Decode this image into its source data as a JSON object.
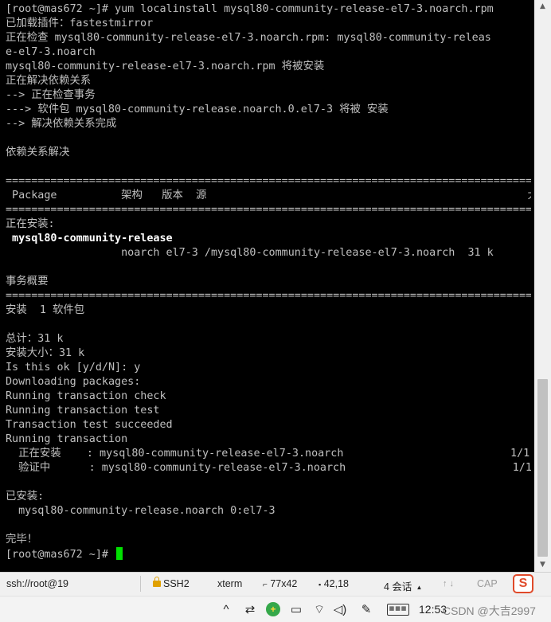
{
  "terminal": {
    "lines": [
      {
        "text": "[root@mas672 ~]# yum localinstall mysql80-community-release-el7-3.noarch.rpm"
      },
      {
        "text": "已加载插件：fastestmirror"
      },
      {
        "text": "正在检查 mysql80-community-release-el7-3.noarch.rpm: mysql80-community-releas"
      },
      {
        "text": "e-el7-3.noarch"
      },
      {
        "text": "mysql80-community-release-el7-3.noarch.rpm 将被安装"
      },
      {
        "text": "正在解决依赖关系"
      },
      {
        "text": "--> 正在检查事务"
      },
      {
        "text": "---> 软件包 mysql80-community-release.noarch.0.el7-3 将被 安装"
      },
      {
        "text": "--> 解决依赖关系完成"
      },
      {
        "text": ""
      },
      {
        "text": "依赖关系解决"
      },
      {
        "text": ""
      },
      {
        "text": "========================================================================================"
      },
      {
        "text": " Package          架构   版本  源                                                  大小"
      },
      {
        "text": "========================================================================================"
      },
      {
        "text": "正在安装:"
      },
      {
        "text": " mysql80-community-release",
        "bold": true
      },
      {
        "text": "                  noarch el7-3 /mysql80-community-release-el7-3.noarch  31 k"
      },
      {
        "text": ""
      },
      {
        "text": "事务概要"
      },
      {
        "text": "========================================================================================"
      },
      {
        "text": "安装  1 软件包"
      },
      {
        "text": ""
      },
      {
        "text": "总计：31 k"
      },
      {
        "text": "安装大小：31 k"
      },
      {
        "text": "Is this ok [y/d/N]: y"
      },
      {
        "text": "Downloading packages:"
      },
      {
        "text": "Running transaction check"
      },
      {
        "text": "Running transaction test"
      },
      {
        "text": "Transaction test succeeded"
      },
      {
        "text": "Running transaction"
      },
      {
        "text": "  正在安装    : mysql80-community-release-el7-3.noarch                          1/1"
      },
      {
        "text": "  验证中      : mysql80-community-release-el7-3.noarch                          1/1"
      },
      {
        "text": ""
      },
      {
        "text": "已安装:"
      },
      {
        "text": "  mysql80-community-release.noarch 0:el7-3"
      },
      {
        "text": ""
      },
      {
        "text": "完毕！"
      }
    ],
    "prompt": "[root@mas672 ~]# ",
    "cursor_color": "#00e000"
  },
  "scrollbar": {
    "up_icon": "▲",
    "down_icon": "▼"
  },
  "statusbar": {
    "session": "ssh://root@19",
    "protocol": "SSH2",
    "terminal_type": "xterm",
    "size_icon": "resize-icon",
    "size": "77x42",
    "position_icon": "cursor-position-icon",
    "position": "42,18",
    "sessions": "4 会话",
    "sessions_caret": "▲",
    "arrows": "↑ ↓",
    "caps": "CAP",
    "ime_logo": "S"
  },
  "taskbar": {
    "chevron": "^",
    "settings_glyph": "⇄",
    "green_glyph": "+",
    "battery_glyph": "▭",
    "wifi_glyph": "⌔",
    "volume_glyph": "◁)",
    "pen_glyph": "✎",
    "keyboard_glyph": "▦▦▦",
    "clock": "12:53",
    "watermark": "CSDN @大吉2997"
  },
  "colors": {
    "terminal_bg": "#000000",
    "terminal_fg": "#c0c0c0",
    "cursor": "#00e000",
    "ime_brand": "#e04a2a"
  }
}
